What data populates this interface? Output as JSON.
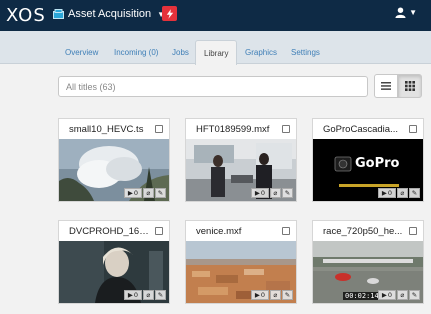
{
  "app": {
    "logo": "XOS",
    "project_name": "Asset Acquisition"
  },
  "tabs": [
    {
      "label": "Overview",
      "active": false
    },
    {
      "label": "Incoming (0)",
      "active": false
    },
    {
      "label": "Jobs",
      "active": false
    },
    {
      "label": "Library",
      "active": true
    },
    {
      "label": "Graphics",
      "active": false
    },
    {
      "label": "Settings",
      "active": false
    }
  ],
  "search": {
    "placeholder": "All titles (63)",
    "value": ""
  },
  "view": {
    "active_mode": "grid",
    "modes": [
      "list",
      "grid"
    ]
  },
  "assets": [
    {
      "title": "small10_HEVC.ts",
      "play_count": "0",
      "timecode": ""
    },
    {
      "title": "HFT0189599.mxf",
      "play_count": "0",
      "timecode": ""
    },
    {
      "title": "GoProCascadia...",
      "play_count": "0",
      "timecode": "",
      "thumb_text": "GoPro"
    },
    {
      "title": "DVCPROHD_16T...",
      "play_count": "0",
      "timecode": ""
    },
    {
      "title": "venice.mxf",
      "play_count": "0",
      "timecode": ""
    },
    {
      "title": "race_720p50_he...",
      "play_count": "0",
      "timecode": "00:02:14"
    }
  ],
  "colors": {
    "topbar": "#0e2a45",
    "accent_link": "#3f7fb7",
    "flash_badge": "#e5323b"
  },
  "icons": [
    "flash-icon",
    "user-icon",
    "list-view-icon",
    "grid-view-icon",
    "play-icon",
    "paperclip-icon",
    "pencil-icon",
    "chevron-down-icon"
  ]
}
